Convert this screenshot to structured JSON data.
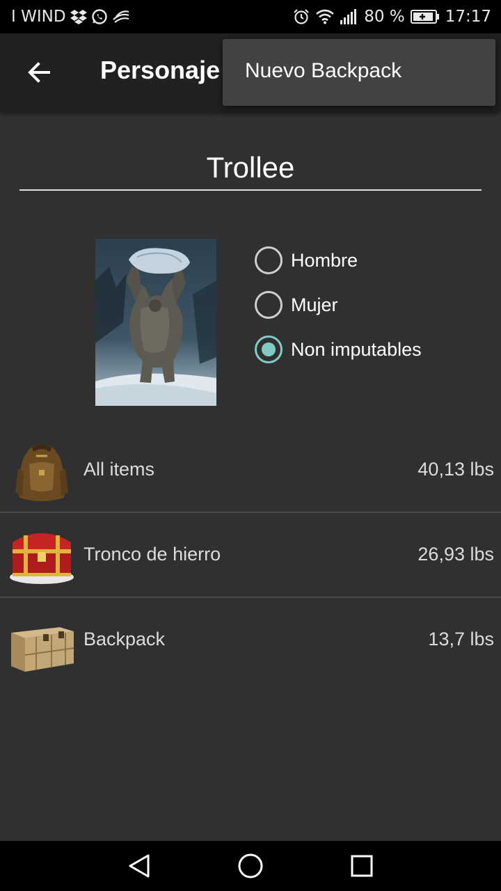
{
  "status_bar": {
    "carrier": "I WIND",
    "battery_percent": "80 %",
    "time": "17:17",
    "icons_left": [
      "dropbox-icon",
      "whatsapp-icon",
      "swiftkey-icon"
    ],
    "icons_right": [
      "alarm-icon",
      "wifi-icon",
      "signal-icon",
      "battery-icon"
    ]
  },
  "app_bar": {
    "title": "Personaje",
    "back_icon": "arrow-back-icon"
  },
  "menu": {
    "items": [
      {
        "label": "Nuevo Backpack"
      }
    ]
  },
  "character": {
    "name": "Trollee",
    "portrait_icon": "troll-portrait-image",
    "gender_options": [
      {
        "label": "Hombre",
        "selected": false
      },
      {
        "label": "Mujer",
        "selected": false
      },
      {
        "label": "Non imputables",
        "selected": true
      }
    ]
  },
  "containers": [
    {
      "name": "All items",
      "weight": "40,13 lbs",
      "icon": "backpack-icon"
    },
    {
      "name": "Tronco de hierro",
      "weight": "26,93 lbs",
      "icon": "treasure-chest-icon"
    },
    {
      "name": "Backpack",
      "weight": "13,7 lbs",
      "icon": "wooden-crate-icon"
    }
  ],
  "colors": {
    "accent": "#80cbc4",
    "background": "#303030",
    "app_bar": "#212121",
    "menu": "#424242"
  },
  "nav_bar": {
    "icons": [
      "nav-back-icon",
      "nav-home-icon",
      "nav-recents-icon"
    ]
  }
}
